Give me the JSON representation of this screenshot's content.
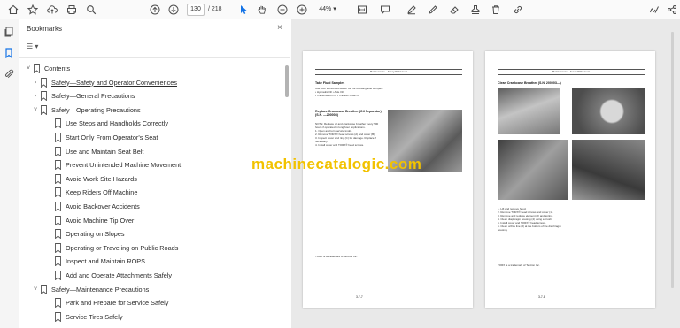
{
  "toolbar": {
    "page_current": "130",
    "page_total": "/ 218",
    "zoom": "44%",
    "icons": [
      "home-icon",
      "star-icon",
      "cloud-upload-icon",
      "print-icon",
      "search-icon",
      "prev-page-icon",
      "next-page-icon",
      "select-cursor-icon",
      "hand-icon",
      "zoom-out-icon",
      "zoom-in-icon",
      "fit-page-icon",
      "highlight-icon",
      "pen-icon",
      "eraser-icon",
      "stamp-icon",
      "trash-icon",
      "link-icon",
      "sign-icon",
      "share-icon"
    ]
  },
  "panel": {
    "title": "Bookmarks",
    "close_glyph": "×",
    "options_glyph": "☰ ▾"
  },
  "bookmarks": [
    {
      "label": "Contents",
      "level": 0,
      "chevron": "˅",
      "link": false
    },
    {
      "label": "Safety—Safety and Operator Conveniences",
      "level": 1,
      "chevron": "›",
      "link": true
    },
    {
      "label": "Safety—General Precautions",
      "level": 1,
      "chevron": "›",
      "link": false
    },
    {
      "label": "Safety—Operating Precautions",
      "level": 1,
      "chevron": "˅",
      "link": false
    },
    {
      "label": "Use Steps and Handholds Correctly",
      "level": 2,
      "chevron": "",
      "link": false
    },
    {
      "label": "Start Only From Operator's Seat",
      "level": 2,
      "chevron": "",
      "link": false
    },
    {
      "label": "Use and Maintain Seat Belt",
      "level": 2,
      "chevron": "",
      "link": false
    },
    {
      "label": "Prevent Unintended Machine Movement",
      "level": 2,
      "chevron": "",
      "link": false
    },
    {
      "label": "Avoid Work Site Hazards",
      "level": 2,
      "chevron": "",
      "link": false
    },
    {
      "label": "Keep Riders Off Machine",
      "level": 2,
      "chevron": "",
      "link": false
    },
    {
      "label": "Avoid Backover Accidents",
      "level": 2,
      "chevron": "",
      "link": false
    },
    {
      "label": "Avoid Machine Tip Over",
      "level": 2,
      "chevron": "",
      "link": false
    },
    {
      "label": "Operating on Slopes",
      "level": 2,
      "chevron": "",
      "link": false
    },
    {
      "label": "Operating or Traveling on Public Roads",
      "level": 2,
      "chevron": "",
      "link": false
    },
    {
      "label": "Inspect and Maintain ROPS",
      "level": 2,
      "chevron": "",
      "link": false
    },
    {
      "label": "Add and Operate Attachments Safely",
      "level": 2,
      "chevron": "",
      "link": false
    },
    {
      "label": "Safety—Maintenance Precautions",
      "level": 1,
      "chevron": "˅",
      "link": false
    },
    {
      "label": "Park and Prepare for Service Safely",
      "level": 2,
      "chevron": "",
      "link": false
    },
    {
      "label": "Service Tires Safely",
      "level": 2,
      "chevron": "",
      "link": false
    }
  ],
  "document": {
    "left_page": {
      "header": "Maintenance—Every 500 Hours",
      "section1_title": "Take Fluid Samples",
      "section1_text": "Use your authorized dealer for the following fluid samples:\n• Hydraulic Oil      • Axle Oil\n• Transmission Oil   • Transfer Case Oil",
      "section2_title": "Replace Crankcase Breather (Oil Separator) (S.N. —200003)",
      "section2_text": "NOTE: Replace oil and crankcase breather every 500 hours if operated in long hour applications.\n1. Open and turn service knob.\n2. Remove TORX® head screws (A) and cover (B).\n3. Inspect cover and ring (C) for damage. Replace if necessary.\n4. Install cover and TORX® head screws.",
      "footer_page": "3-7-7",
      "footer_note": "TORX is a trademark of Textron Inc."
    },
    "right_page": {
      "header": "Maintenance—Every 500 Hours",
      "section1_title": "Clean Crankcase Breather (S.N. 200003—)",
      "section1_text": "1. Lift and remove hood.\n2. Remove TORX® head screws and cover (1).\n3. Remove and replace element (2) and spring.\n4. Clean diaphragm housing (4) using a brush.\n5. Install cover and TORX® head screws.\n6. Clean orifice line (5) at the bottom of the diaphragm housing.",
      "footer_page": "3-7-8",
      "footer_note": "TORX is a trademark of Textron Inc."
    },
    "watermark": "machinecatalogic.com"
  },
  "colors": {
    "accent": "#1473e6",
    "watermark": "#f2c200",
    "doc_background": "#e9e9e9"
  }
}
